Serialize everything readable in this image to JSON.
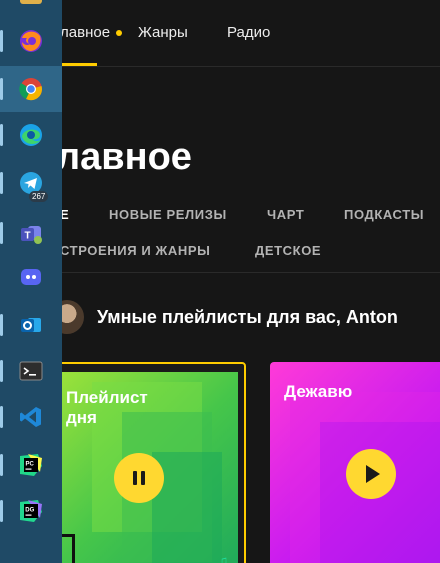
{
  "taskbar": {
    "items": [
      {
        "name": "firefox"
      },
      {
        "name": "chrome",
        "active": true
      },
      {
        "name": "edge"
      },
      {
        "name": "telegram",
        "badge": "267"
      },
      {
        "name": "teams"
      },
      {
        "name": "discord"
      },
      {
        "name": "outlook"
      },
      {
        "name": "terminal"
      },
      {
        "name": "vscode"
      },
      {
        "name": "pycharm"
      },
      {
        "name": "datagrip"
      }
    ]
  },
  "nav": {
    "main": "лавное",
    "genres": "Жанры",
    "radio": "Радио"
  },
  "page_title": "лавное",
  "tabs": {
    "row1": [
      "Е",
      "НОВЫЕ РЕЛИЗЫ",
      "ЧАРТ",
      "ПОДКАСТЫ"
    ],
    "row2": [
      "СТРОЕНИЯ И ЖАНРЫ",
      "ДЕТСКОЕ"
    ]
  },
  "section": {
    "title": "Умные плейлисты для вас, Anton"
  },
  "cards": [
    {
      "title": "Плейлист\nдня",
      "state": "playing"
    },
    {
      "title": "Дежавю",
      "state": "paused"
    }
  ],
  "colors": {
    "accent": "#ffcc00",
    "taskbar": "#1f4a66",
    "background": "#161616"
  }
}
